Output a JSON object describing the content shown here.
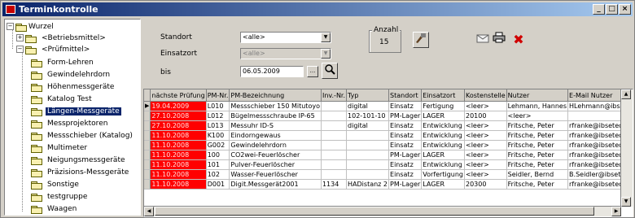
{
  "window": {
    "title": "Terminkontrolle",
    "min": "_",
    "max": "□",
    "close": "×"
  },
  "tree": {
    "root": "Wurzel",
    "nodes": [
      {
        "label": "<Betriebsmittel>",
        "expander": "+"
      },
      {
        "label": "<Prüfmittel>",
        "expander": "−"
      },
      {
        "label": "Form-Lehren"
      },
      {
        "label": "Gewindelehrdorn"
      },
      {
        "label": "Höhenmessgeräte"
      },
      {
        "label": "Katalog Test"
      },
      {
        "label": "Längen-Messgeräte"
      },
      {
        "label": "Messprojektoren"
      },
      {
        "label": "Messschieber (Katalog)"
      },
      {
        "label": "Multimeter"
      },
      {
        "label": "Neigungsmessgeräte"
      },
      {
        "label": "Präzisions-Messgeräte"
      },
      {
        "label": "Sonstige"
      },
      {
        "label": "testgruppe"
      },
      {
        "label": "Waagen"
      }
    ],
    "selected": "Längen-Messgeräte"
  },
  "filter": {
    "standort_label": "Standort",
    "standort_value": "<alle>",
    "einsatzort_label": "Einsatzort",
    "einsatzort_value": "<alle>",
    "bis_label": "bis",
    "bis_value": "06.05.2009",
    "dots": "...",
    "anzahl_label": "Anzahl",
    "anzahl_value": "15"
  },
  "grid": {
    "columns": [
      "nächste Prüfung",
      "PM-Nr.",
      "PM-Bezeichnung",
      "Inv.-Nr.",
      "Typ",
      "Standort",
      "Einsatzort",
      "Kostenstelle",
      "Nutzer",
      "E-Mail Nutzer",
      "A"
    ],
    "rows": [
      [
        "19.04.2009",
        "L010",
        "Messschieber 150 Mitutoyo",
        "",
        "digital",
        "Einsatz",
        "Fertigung",
        "<leer>",
        "Lehmann, Hannes",
        "HLehmann@ibseteq.de",
        ""
      ],
      [
        "27.10.2008",
        "L012",
        "Bügelmessschraube IP-65",
        "",
        "102-101-10",
        "PM-Lager",
        "LAGER",
        "20100",
        "<leer>",
        "",
        ""
      ],
      [
        "27.10.2008",
        "L013",
        "Messuhr ID-S",
        "",
        "digital",
        "Einsatz",
        "Entwicklung",
        "<leer>",
        "Fritsche, Peter",
        "rfranke@ibseteq.de",
        ""
      ],
      [
        "11.10.2008",
        "K100",
        "Eindorngewaus",
        "",
        "",
        "Einsatz",
        "Entwicklung",
        "<leer>",
        "Fritsche, Peter",
        "rfranke@ibseteq.de",
        ""
      ],
      [
        "11.10.2008",
        "G002",
        "Gewindelehrdorn",
        "",
        "",
        "Einsatz",
        "Entwicklung",
        "<leer>",
        "Fritsche, Peter",
        "rfranke@ibseteq.de",
        ""
      ],
      [
        "11.10.2008",
        "100",
        "CO2wei-Feuerlöscher",
        "",
        "",
        "PM-Lager",
        "LAGER",
        "<leer>",
        "Fritsche, Peter",
        "rfranke@ibseteq.de",
        ""
      ],
      [
        "11.10.2008",
        "101",
        "Pulver-Feuerlöscher",
        "",
        "",
        "Einsatz",
        "Entwicklung",
        "<leer>",
        "Fritsche, Peter",
        "rfranke@ibseteq.de",
        ""
      ],
      [
        "11.10.2008",
        "102",
        "Wasser-Feuerlöscher",
        "",
        "",
        "Einsatz",
        "Vorfertigung",
        "<leer>",
        "Seidler, Bernd",
        "B.Seidler@ibseteq.de",
        ""
      ],
      [
        "11.10.2008",
        "D001",
        "Digit.Messgerät2001",
        "1134",
        "HADistanz 2",
        "PM-Lager",
        "LAGER",
        "20300",
        "Fritsche, Peter",
        "rfranke@ibseteq.de",
        ""
      ]
    ],
    "row_marker": "▶"
  }
}
